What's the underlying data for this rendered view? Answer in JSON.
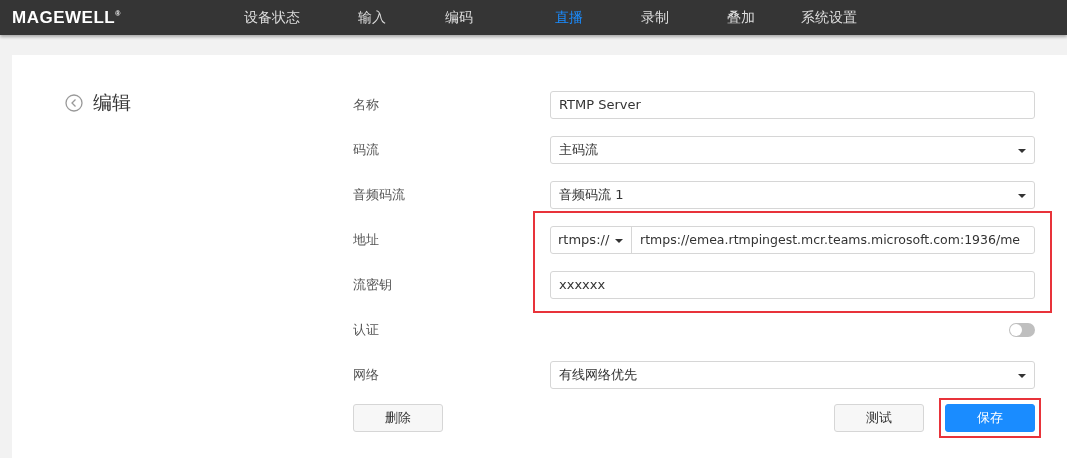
{
  "nav": {
    "logo": "MAGEWELL",
    "logo_mark": "®",
    "items": [
      {
        "label": "设备状态",
        "selected": false
      },
      {
        "label": "输入",
        "selected": false
      },
      {
        "label": "编码",
        "selected": false
      },
      {
        "label": "直播",
        "selected": true
      },
      {
        "label": "录制",
        "selected": false
      },
      {
        "label": "叠加",
        "selected": false
      },
      {
        "label": "系统设置",
        "selected": false
      }
    ]
  },
  "page": {
    "title": "编辑"
  },
  "form": {
    "rows": [
      {
        "kind": "text",
        "label": "名称",
        "value": "RTMP Server",
        "highlighted": false
      },
      {
        "kind": "select",
        "label": "码流",
        "value": "主码流",
        "highlighted": false
      },
      {
        "kind": "select",
        "label": "音频码流",
        "value": "音频码流 1",
        "highlighted": false
      },
      {
        "kind": "address",
        "label": "地址",
        "prefix": "rtmps://",
        "value": "rtmps://emea.rtmpingest.mcr.teams.microsoft.com:1936/me",
        "highlighted": true
      },
      {
        "kind": "text",
        "label": "流密钥",
        "value": "xxxxxx",
        "highlighted": true
      },
      {
        "kind": "toggle",
        "label": "认证",
        "on": false,
        "highlighted": false
      },
      {
        "kind": "select",
        "label": "网络",
        "value": "有线网络优先",
        "highlighted": false
      }
    ]
  },
  "buttons": {
    "left": [
      {
        "label": "删除",
        "kind": "default",
        "highlighted": false
      }
    ],
    "right": [
      {
        "label": "测试",
        "kind": "default",
        "highlighted": false
      },
      {
        "label": "保存",
        "kind": "primary",
        "highlighted": true
      }
    ]
  }
}
